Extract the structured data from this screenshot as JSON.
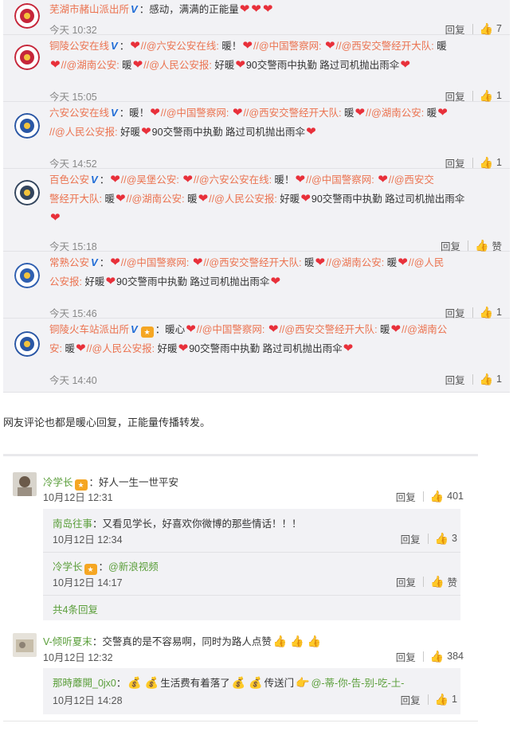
{
  "comments_top": [
    {
      "user": "芜湖市赭山派出所",
      "body_parts": [
        {
          "t": "：感动，满满的正能量"
        },
        {
          "h": 3
        }
      ],
      "time": "今天 10:32",
      "reply": "回复",
      "likes": "7"
    },
    {
      "user": "铜陵公安在线",
      "body_parts": [
        {
          "t": "："
        },
        {
          "h": 1
        },
        {
          "a": "//@六安公安在线:"
        },
        {
          "t": " 暖！"
        },
        {
          "h": 1
        },
        {
          "a": "//@中国警察网:"
        },
        {
          "t": " "
        },
        {
          "h": 1
        },
        {
          "a": "//@西安交警经开大队:"
        },
        {
          "t": " 暖"
        },
        {
          "br": true
        },
        {
          "h": 1
        },
        {
          "a": "//@湖南公安:"
        },
        {
          "t": " 暖"
        },
        {
          "h": 1
        },
        {
          "a": "//@人民公安报:"
        },
        {
          "t": " 好暖"
        },
        {
          "h": 1
        },
        {
          "t": "90交警雨中执勤 路过司机抛出雨伞"
        },
        {
          "h": 1
        }
      ],
      "time": "今天 15:05",
      "reply": "回复",
      "likes": "1"
    },
    {
      "user": "六安公安在线",
      "body_parts": [
        {
          "t": "：暖！"
        },
        {
          "h": 1
        },
        {
          "a": "//@中国警察网:"
        },
        {
          "t": " "
        },
        {
          "h": 1
        },
        {
          "a": "//@西安交警经开大队:"
        },
        {
          "t": " 暖"
        },
        {
          "h": 1
        },
        {
          "a": "//@湖南公安:"
        },
        {
          "t": " 暖"
        },
        {
          "h": 1
        },
        {
          "br": true
        },
        {
          "a": "//@人民公安报:"
        },
        {
          "t": " 好暖"
        },
        {
          "h": 1
        },
        {
          "t": "90交警雨中执勤 路过司机抛出雨伞"
        },
        {
          "h": 1
        }
      ],
      "time": "今天 14:52",
      "reply": "回复",
      "likes": "1"
    },
    {
      "user": "百色公安",
      "body_parts": [
        {
          "t": "："
        },
        {
          "h": 1
        },
        {
          "a": "//@吴堡公安:"
        },
        {
          "t": " "
        },
        {
          "h": 1
        },
        {
          "a": "//@六安公安在线:"
        },
        {
          "t": " 暖！"
        },
        {
          "h": 1
        },
        {
          "a": "//@中国警察网:"
        },
        {
          "t": " "
        },
        {
          "h": 1
        },
        {
          "a": "//@西安交"
        },
        {
          "br": true
        },
        {
          "a": "警经开大队:"
        },
        {
          "t": " 暖"
        },
        {
          "h": 1
        },
        {
          "a": "//@湖南公安:"
        },
        {
          "t": " 暖"
        },
        {
          "h": 1
        },
        {
          "a": "//@人民公安报:"
        },
        {
          "t": " 好暖"
        },
        {
          "h": 1
        },
        {
          "t": "90交警雨中执勤 路过司机抛出雨伞"
        },
        {
          "br": true
        },
        {
          "h": 1
        }
      ],
      "time": "今天 15:18",
      "reply": "回复",
      "likes": "赞"
    },
    {
      "user": "常熟公安",
      "body_parts": [
        {
          "t": "："
        },
        {
          "h": 1
        },
        {
          "a": "//@中国警察网:"
        },
        {
          "t": " "
        },
        {
          "h": 1
        },
        {
          "a": "//@西安交警经开大队:"
        },
        {
          "t": " 暖"
        },
        {
          "h": 1
        },
        {
          "a": "//@湖南公安:"
        },
        {
          "t": " 暖"
        },
        {
          "h": 1
        },
        {
          "a": "//@人民"
        },
        {
          "br": true
        },
        {
          "a": "公安报:"
        },
        {
          "t": " 好暖"
        },
        {
          "h": 1
        },
        {
          "t": "90交警雨中执勤 路过司机抛出雨伞"
        },
        {
          "h": 1
        }
      ],
      "time": "今天 15:46",
      "reply": "回复",
      "likes": "1"
    },
    {
      "user": "铜陵火车站派出所",
      "body_parts": [
        {
          "t": "：暖心"
        },
        {
          "h": 1
        },
        {
          "a": "//@中国警察网:"
        },
        {
          "t": " "
        },
        {
          "h": 1
        },
        {
          "a": "//@西安交警经开大队:"
        },
        {
          "t": " 暖"
        },
        {
          "h": 1
        },
        {
          "a": "//@湖南公"
        },
        {
          "br": true
        },
        {
          "a": "安:"
        },
        {
          "t": " 暖"
        },
        {
          "h": 1
        },
        {
          "a": "//@人民公安报:"
        },
        {
          "t": " 好暖"
        },
        {
          "h": 1
        },
        {
          "t": "90交警雨中执勤 路过司机抛出雨伞"
        },
        {
          "h": 1
        }
      ],
      "time": "今天 14:40",
      "reply": "回复",
      "likes": "1"
    }
  ],
  "caption": "网友评论也都是暖心回复，正能量传播转发。",
  "shot2": {
    "c1": {
      "user": "冷学长",
      "text": "：好人一生一世平安",
      "time": "10月12日 12:31",
      "reply": "回复",
      "likes": "401"
    },
    "sub": [
      {
        "user": "南岛往事",
        "text": "：又看见学长，好喜欢你微博的那些情话！！！",
        "time": "10月12日 12:34",
        "reply": "回复",
        "likes": "3"
      },
      {
        "user": "冷学长",
        "text": "：",
        "at": "@新浪视频",
        "time": "10月12日 14:17",
        "reply": "回复",
        "likes": "赞"
      }
    ],
    "more": "共4条回复",
    "c2": {
      "user": "V-倾听夏末",
      "text": "：交警真的是不容易啊，同时为路人点赞",
      "time": "10月12日 12:32",
      "reply": "回复",
      "likes": "384"
    },
    "sub2": {
      "user": "那時蘼開_0jx0",
      "text_a": "：",
      "text_b": "生活费有着落了",
      "text_c": "传送门",
      "at": "@-蒂-你-告-别-吃-土-",
      "time": "10月12日 14:28",
      "reply": "回复",
      "likes": "1"
    }
  },
  "colors": {
    "username": "#eb7350",
    "heart": "#e8303a",
    "verified": "#1e6bd6",
    "green_link": "#5a9e3a",
    "panel_bg": "#f2f2f5"
  }
}
